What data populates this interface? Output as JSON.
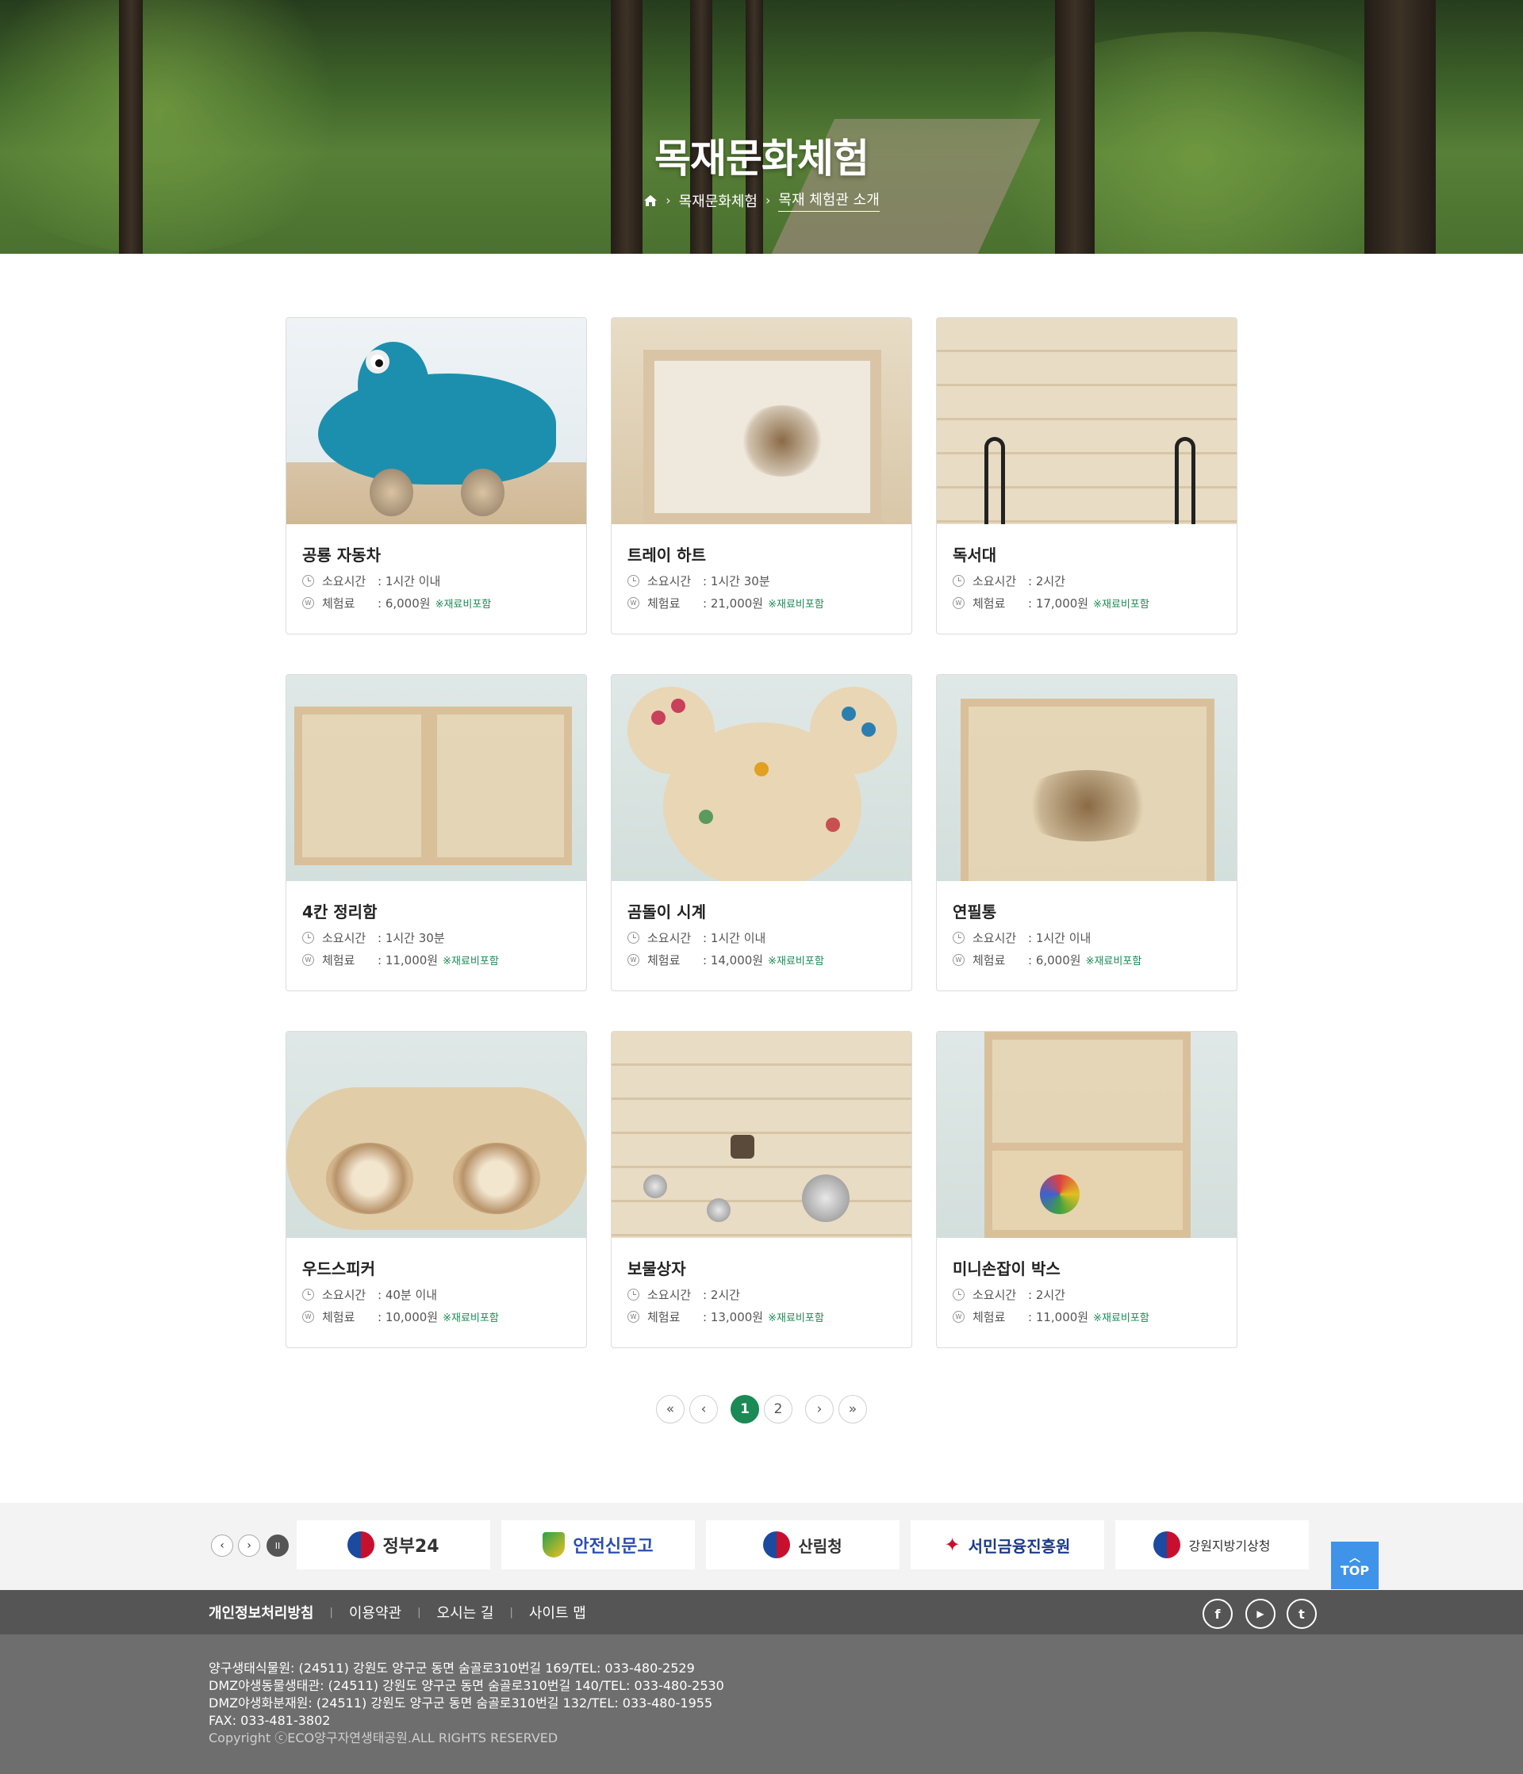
{
  "hero": {
    "title": "목재문화체험",
    "breadcrumb": [
      "목재문화체험",
      "목재 체험관 소개"
    ]
  },
  "cards": [
    {
      "title": "공룡 자동차",
      "time_label": "소요시간",
      "time": ": 1시간 이내",
      "fee_label": "체험료",
      "fee": ": 6,000원",
      "note": "※재료비포함"
    },
    {
      "title": "트레이 하트",
      "time_label": "소요시간",
      "time": ": 1시간 30분",
      "fee_label": "체험료",
      "fee": ": 21,000원",
      "note": "※재료비포함"
    },
    {
      "title": "독서대",
      "time_label": "소요시간",
      "time": ": 2시간",
      "fee_label": "체험료",
      "fee": ": 17,000원",
      "note": "※재료비포함"
    },
    {
      "title": "4칸 정리함",
      "time_label": "소요시간",
      "time": ": 1시간 30분",
      "fee_label": "체험료",
      "fee": ": 11,000원",
      "note": "※재료비포함"
    },
    {
      "title": "곰돌이 시계",
      "time_label": "소요시간",
      "time": ": 1시간 이내",
      "fee_label": "체험료",
      "fee": ": 14,000원",
      "note": "※재료비포함"
    },
    {
      "title": "연필통",
      "time_label": "소요시간",
      "time": ": 1시간 이내",
      "fee_label": "체험료",
      "fee": ": 6,000원",
      "note": "※재료비포함"
    },
    {
      "title": "우드스피커",
      "time_label": "소요시간",
      "time": ": 40분 이내",
      "fee_label": "체험료",
      "fee": ": 10,000원",
      "note": "※재료비포함"
    },
    {
      "title": "보물상자",
      "time_label": "소요시간",
      "time": ": 2시간",
      "fee_label": "체험료",
      "fee": ": 13,000원",
      "note": "※재료비포함"
    },
    {
      "title": "미니손잡이 박스",
      "time_label": "소요시간",
      "time": ": 2시간",
      "fee_label": "체험료",
      "fee": ": 11,000원",
      "note": "※재료비포함"
    }
  ],
  "pagination": {
    "first": "«",
    "prev": "‹",
    "pages": [
      "1",
      "2"
    ],
    "current": "1",
    "next": "›",
    "last": "»"
  },
  "banners": {
    "prev": "‹",
    "next": "›",
    "pause": "II",
    "items": [
      "정부24",
      "안전신문고",
      "산림청",
      "서민금융진흥원",
      "강원지방기상청"
    ]
  },
  "top_button": "TOP",
  "footer": {
    "links": [
      "개인정보처리방침",
      "이용약관",
      "오시는 길",
      "사이트 맵"
    ],
    "social": [
      "f",
      "▶",
      "t"
    ],
    "address_lines": [
      "양구생태식물원: (24511) 강원도 양구군 동면 숨골로310번길 169/TEL: 033-480-2529",
      "DMZ야생동물생태관: (24511) 강원도 양구군 동면 숨골로310번길 140/TEL: 033-480-2530",
      "DMZ야생화분재원: (24511) 강원도 양구군 동면 숨골로310번길 132/TEL: 033-480-1955",
      "FAX: 033-481-3802"
    ],
    "copyright": "Copyright ⓒECO양구자연생태공원.ALL RIGHTS RESERVED"
  },
  "colors": {
    "accent": "#1b8a55",
    "top_button": "#3f93e8",
    "footer_nav": "#555555",
    "footer_info": "#6e6e6e"
  }
}
